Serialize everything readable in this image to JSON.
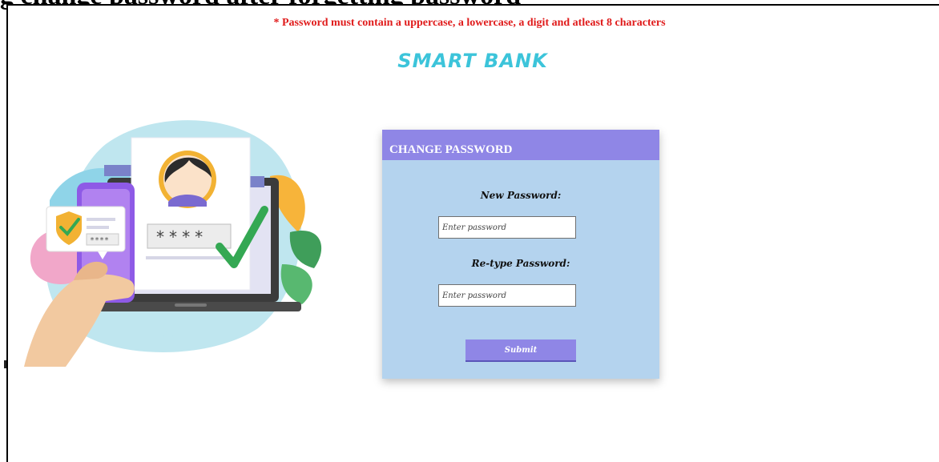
{
  "document": {
    "heading_cut": "g change password after forgetting password"
  },
  "page": {
    "password_rule": "* Password must contain a uppercase, a lowercase, a digit and atleast 8 characters",
    "brand": "SMART BANK"
  },
  "illustration": {
    "masked_dots_phone": "****",
    "masked_dots_screen": "****"
  },
  "form": {
    "title": "CHANGE PASSWORD",
    "new_password_label": "New Password:",
    "new_password_placeholder": "Enter password",
    "retype_password_label": "Re-type Password:",
    "retype_password_placeholder": "Enter password",
    "submit_label": "Submit"
  },
  "colors": {
    "accent": "#8f86e6",
    "card_bg": "#b4d3ee",
    "brand": "#3cc4da",
    "warning": "#e01b1b"
  }
}
